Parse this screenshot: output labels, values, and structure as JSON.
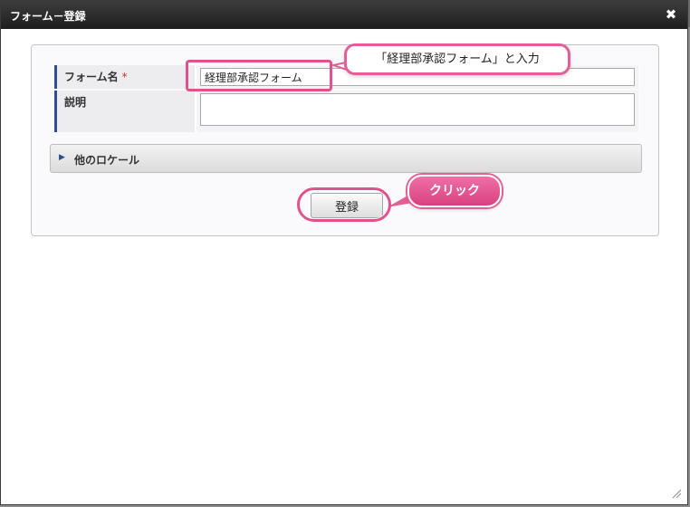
{
  "dialog": {
    "title": "フォーム－登録",
    "close_icon": "close-icon"
  },
  "form": {
    "name_label": "フォーム名",
    "required_mark": "*",
    "name_value": "経理部承認フォーム",
    "description_label": "説明",
    "description_value": ""
  },
  "locale_section": {
    "label": "他のロケール",
    "icon": "triangle-right-icon"
  },
  "actions": {
    "register_label": "登録"
  },
  "annotations": {
    "input_callout": "「経理部承認フォーム」と入力",
    "click_callout": "クリック",
    "highlight_color": "#e0528d"
  }
}
